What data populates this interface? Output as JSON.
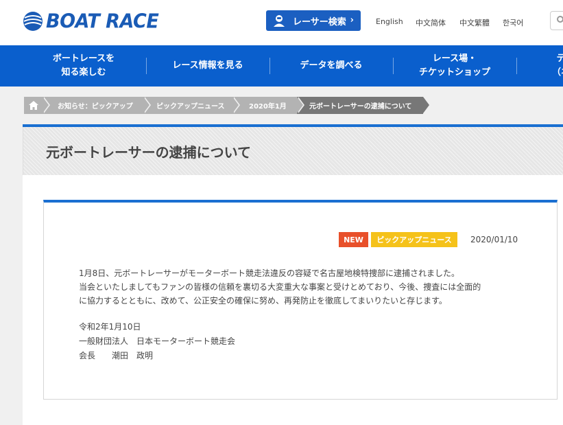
{
  "header": {
    "logo_text": "BOAT RACE",
    "racer_search_label": "レーサー検索",
    "languages": [
      "English",
      "中文简体",
      "中文繁體",
      "한국어"
    ]
  },
  "nav": {
    "items": [
      {
        "label": "ボートレースを\n知る楽しむ"
      },
      {
        "label": "レース情報を見る"
      },
      {
        "label": "データを調べる"
      },
      {
        "label": "レース場・\nチケットショップ"
      },
      {
        "label": "テ\n（ネ"
      }
    ]
  },
  "breadcrumb": {
    "items": [
      "お知らせ：ピックアップ",
      "ピックアップニュース",
      "2020年1月",
      "元ボートレーサーの逮捕について"
    ]
  },
  "page": {
    "title": "元ボートレーサーの逮捕について"
  },
  "article": {
    "tag_new": "NEW",
    "tag_category": "ピックアップニュース",
    "date": "2020/01/10",
    "paragraph_lines": [
      "1月8日、元ボートレーサーがモーターボート競走法違反の容疑で名古屋地検特捜部に逮捕されました。",
      "当会といたしましてもファンの皆様の信頼を裏切る大変重大な事案と受けとめており、今後、捜査には全面的",
      "に協力するとともに、改めて、公正安全の確保に努め、再発防止を徹底してまいりたいと存じます。"
    ],
    "signature_date": "令和2年1月10日",
    "signature_org": "一般財団法人　日本モーターボート競走会",
    "signature_person": "会長　　潮田　政明"
  },
  "colors": {
    "brand_blue": "#0a5fcd",
    "new_tag": "#e8502a",
    "category_tag": "#f5c21a"
  }
}
